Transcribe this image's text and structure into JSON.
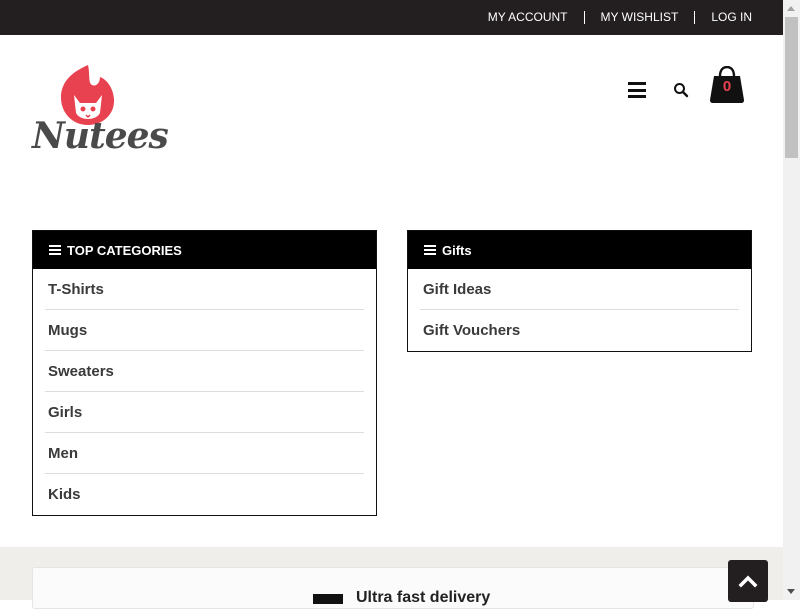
{
  "topbar": {
    "links": [
      "MY ACCOUNT",
      "MY WISHLIST",
      "LOG IN"
    ]
  },
  "brand": {
    "name": "Nutees",
    "accent_color": "#e8414f"
  },
  "header": {
    "cart_count": "0",
    "icons": [
      "menu-icon",
      "search-icon",
      "shopping-bag-icon"
    ]
  },
  "top_categories": {
    "title": "TOP CATEGORIES",
    "items": [
      "T-Shirts",
      "Mugs",
      "Sweaters",
      "Girls",
      "Men",
      "Kids"
    ]
  },
  "gifts": {
    "title": "Gifts",
    "items": [
      "Gift Ideas",
      "Gift Vouchers"
    ]
  },
  "features": {
    "title": "Ultra fast delivery"
  }
}
